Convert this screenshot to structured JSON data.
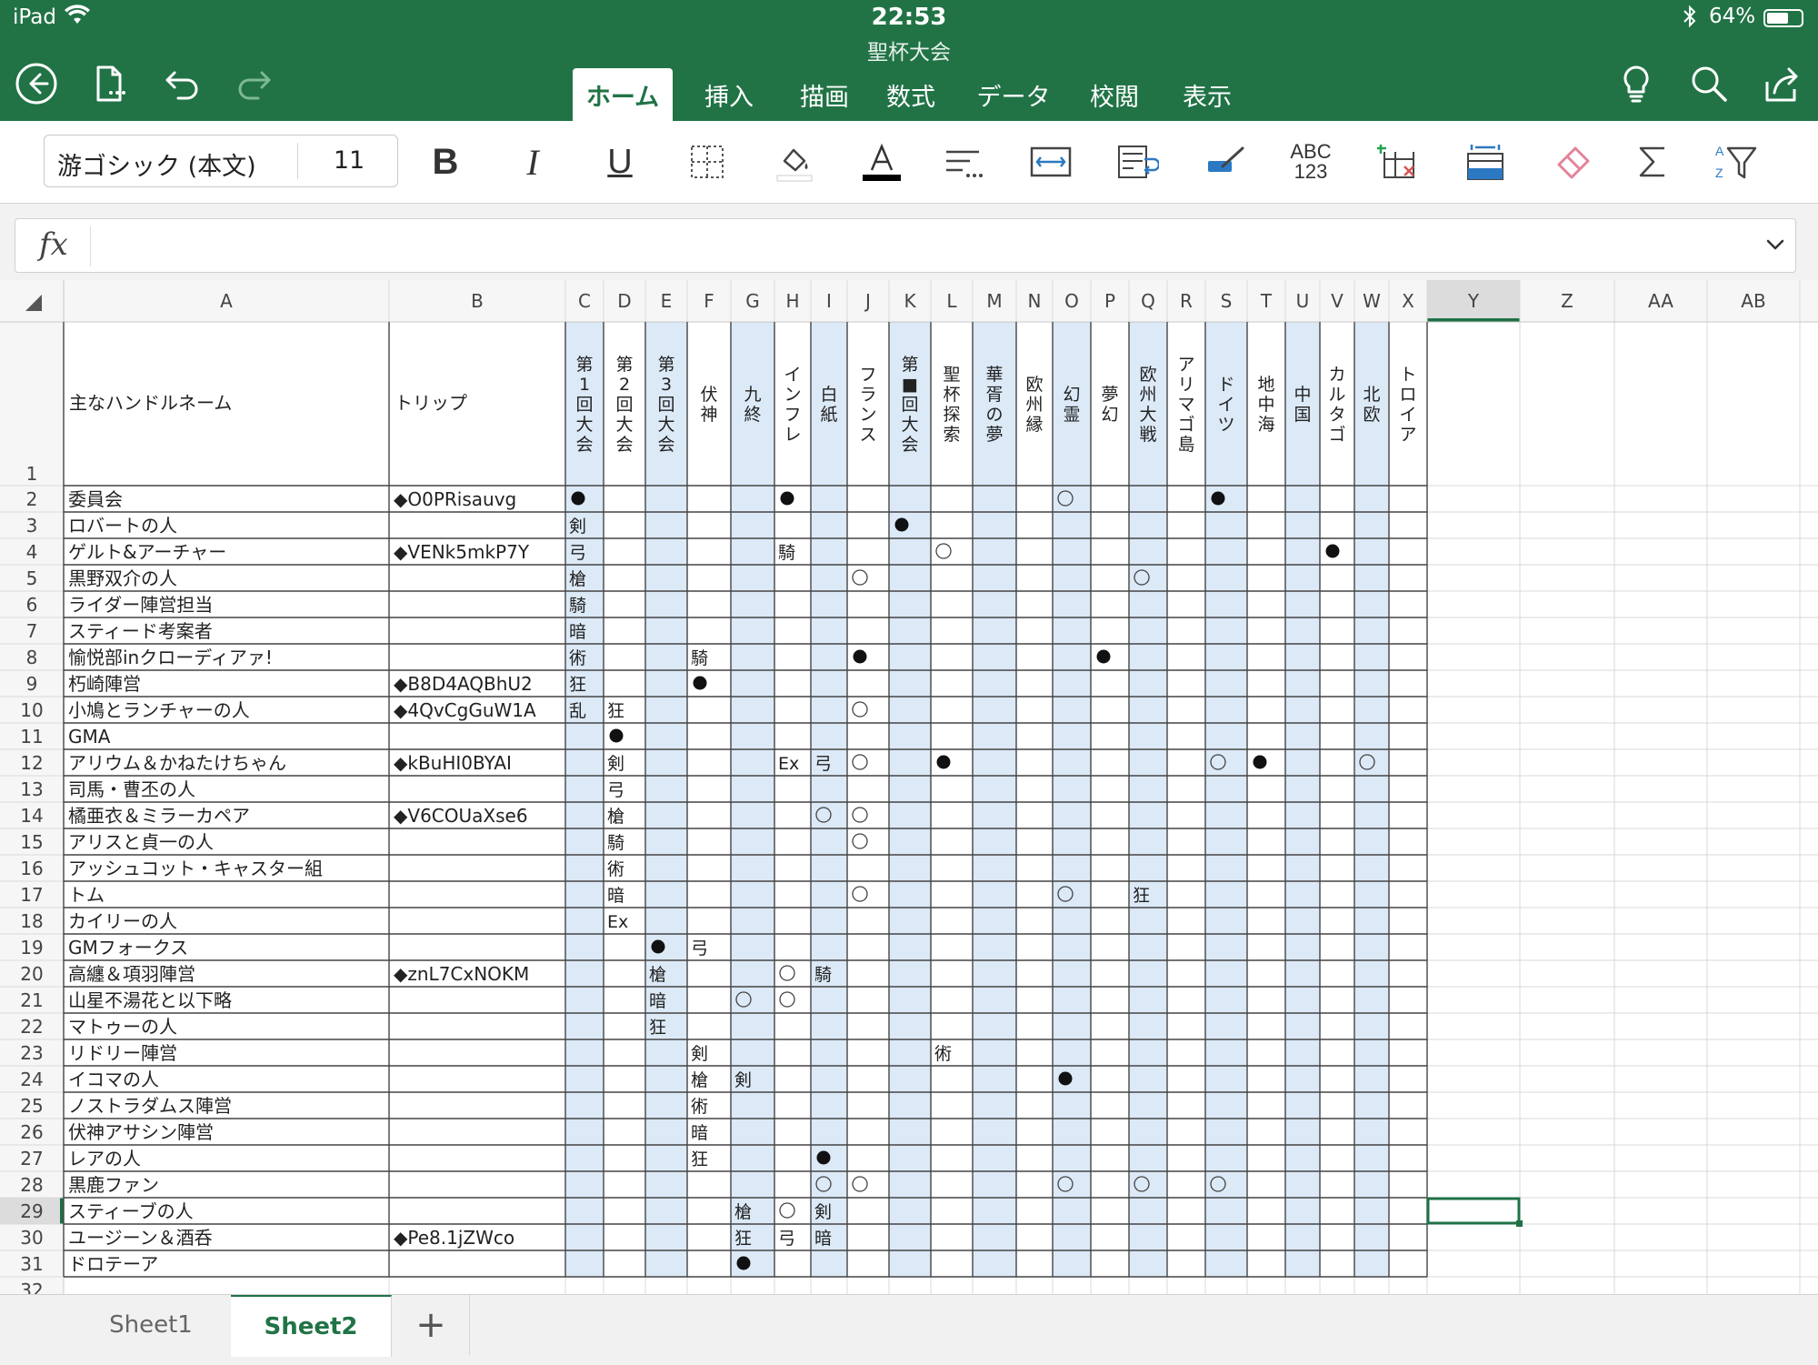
{
  "status": {
    "device": "iPad",
    "time": "22:53",
    "battery": "64%",
    "battery_level": 0.64
  },
  "title": "聖杯大会",
  "ribbon_tabs": [
    "ホーム",
    "挿入",
    "描画",
    "数式",
    "データ",
    "校閲",
    "表示"
  ],
  "active_tab": 0,
  "toolbar": {
    "font_name": "游ゴシック (本文)",
    "font_size": "11",
    "bold": "B",
    "italic": "I",
    "underline": "U",
    "abc": "ABC",
    "abc_num": "123"
  },
  "formula": {
    "label": "fx",
    "value": ""
  },
  "colors": {
    "brand": "#217346",
    "blue_col": "#dce9f7",
    "selection": "#1e7145"
  },
  "columns": [
    "A",
    "B",
    "C",
    "D",
    "E",
    "F",
    "G",
    "H",
    "I",
    "J",
    "K",
    "L",
    "M",
    "N",
    "O",
    "P",
    "Q",
    "R",
    "S",
    "T",
    "U",
    "V",
    "W",
    "X",
    "Y",
    "Z",
    "AA",
    "AB"
  ],
  "selected_row": 29,
  "selected_col": "Y",
  "headers": {
    "A": "主なハンドルネーム",
    "B": "トリップ",
    "C": "第1回大会",
    "D": "第2回大会",
    "E": "第3回大会",
    "F": "伏神",
    "G": "九終",
    "H": "インフレ",
    "I": "白紙",
    "J": "フランス",
    "K": "第■回大会",
    "L": "聖杯探索",
    "M": "華胥の夢",
    "N": "欧州縁",
    "O": "幻霊",
    "P": "夢幻",
    "Q": "欧州大戦",
    "R": "アリマゴ島",
    "S": "ドイツ",
    "T": "地中海",
    "U": "中国",
    "V": "カルタゴ",
    "W": "北欧",
    "X": "トロイア"
  },
  "rows": [
    {
      "r": 2,
      "A": "委員会",
      "B": "◆O0PRisauvg",
      "C": "●",
      "H": "●",
      "O": "○",
      "S": "●"
    },
    {
      "r": 3,
      "A": "ロバートの人",
      "C": "剣",
      "K": "●"
    },
    {
      "r": 4,
      "A": "ゲルト&アーチャー",
      "B": "◆VENk5mkP7Y",
      "C": "弓",
      "H": "騎",
      "L": "○",
      "V": "●"
    },
    {
      "r": 5,
      "A": "黒野双介の人",
      "C": "槍",
      "J": "○",
      "Q": "○"
    },
    {
      "r": 6,
      "A": "ライダー陣営担当",
      "C": "騎"
    },
    {
      "r": 7,
      "A": "スティード考案者",
      "C": "暗"
    },
    {
      "r": 8,
      "A": "愉悦部inクローディアァ!",
      "C": "術",
      "F": "騎",
      "J": "●",
      "P": "●"
    },
    {
      "r": 9,
      "A": "朽崎陣営",
      "B": "◆B8D4AQBhU2",
      "C": "狂",
      "F": "●"
    },
    {
      "r": 10,
      "A": "小鳩とランチャーの人",
      "B": "◆4QvCgGuW1A",
      "C": "乱",
      "D": "狂",
      "J": "○"
    },
    {
      "r": 11,
      "A": "GMA",
      "D": "●"
    },
    {
      "r": 12,
      "A": "アリウム＆かねたけちゃん",
      "B": "◆kBuHI0BYAI",
      "D": "剣",
      "H": "Ex",
      "I": "弓",
      "J": "○",
      "L": "●",
      "S": "○",
      "T": "●",
      "W": "○"
    },
    {
      "r": 13,
      "A": "司馬・曹丕の人",
      "D": "弓"
    },
    {
      "r": 14,
      "A": "橘亜衣＆ミラーカペア",
      "B": "◆V6COUaXse6",
      "D": "槍",
      "I": "○",
      "J": "○"
    },
    {
      "r": 15,
      "A": "アリスと貞一の人",
      "D": "騎",
      "J": "○"
    },
    {
      "r": 16,
      "A": "アッシュコット・キャスター組",
      "D": "術"
    },
    {
      "r": 17,
      "A": "トム",
      "D": "暗",
      "J": "○",
      "O": "○",
      "Q": "狂"
    },
    {
      "r": 18,
      "A": "カイリーの人",
      "D": "Ex"
    },
    {
      "r": 19,
      "A": "GMフォークス",
      "E": "●",
      "F": "弓"
    },
    {
      "r": 20,
      "A": "高纏＆項羽陣営",
      "B": "◆znL7CxNOKM",
      "E": "槍",
      "H": "○",
      "I": "騎"
    },
    {
      "r": 21,
      "A": "山星不湯花と以下略",
      "E": "暗",
      "G": "○",
      "H": "○"
    },
    {
      "r": 22,
      "A": "マトゥーの人",
      "E": "狂"
    },
    {
      "r": 23,
      "A": "リドリー陣営",
      "F": "剣",
      "L": "術"
    },
    {
      "r": 24,
      "A": "イコマの人",
      "F": "槍",
      "G": "剣",
      "O": "●"
    },
    {
      "r": 25,
      "A": "ノストラダムス陣営",
      "F": "術"
    },
    {
      "r": 26,
      "A": "伏神アサシン陣営",
      "F": "暗"
    },
    {
      "r": 27,
      "A": "レアの人",
      "F": "狂",
      "I": "●"
    },
    {
      "r": 28,
      "A": "黒鹿ファン",
      "I": "○",
      "J": "○",
      "O": "○",
      "Q": "○",
      "S": "○"
    },
    {
      "r": 29,
      "A": "スティーブの人",
      "G": "槍",
      "H": "○",
      "I": "剣"
    },
    {
      "r": 30,
      "A": "ユージーン＆酒呑",
      "B": "◆Pe8.1jZWco",
      "G": "狂",
      "H": "弓",
      "I": "暗"
    },
    {
      "r": 31,
      "A": "ドロテーア",
      "G": "●"
    },
    {
      "r": 32
    }
  ],
  "sheets": [
    "Sheet1",
    "Sheet2"
  ],
  "active_sheet": 1,
  "add_sheet": "+"
}
